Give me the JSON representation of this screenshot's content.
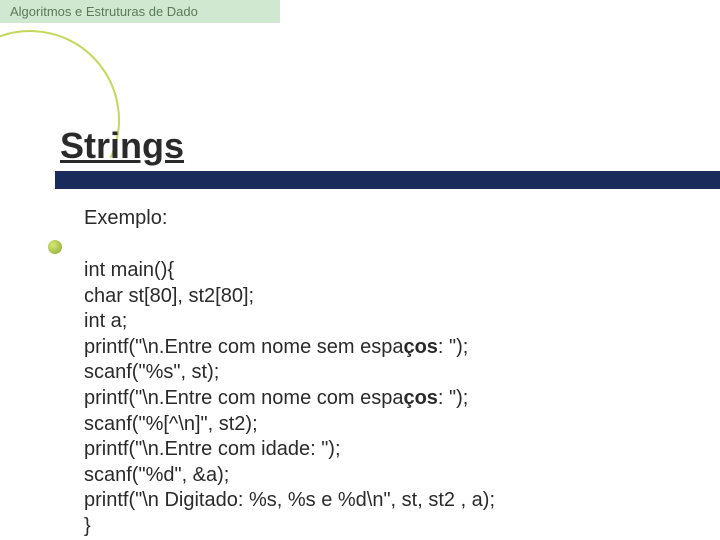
{
  "header": {
    "text": "Algoritmos e Estruturas de Dado"
  },
  "slide": {
    "title": "Strings",
    "subtitle": "Exemplo:",
    "code": {
      "l1": "int main(){",
      "l2": "char st[80], st2[80];",
      "l3": "int a;",
      "l4a": "printf(\"\\n.Entre com nome sem espa",
      "l4b": "ços",
      "l4c": ": \");",
      "l5": "scanf(\"%s\", st);",
      "l6a": "printf(\"\\n.Entre com nome com espa",
      "l6b": "ços",
      "l6c": ": \");",
      "l7": "scanf(\"%[^\\n]\", st2);",
      "l8": "printf(\"\\n.Entre com idade: \");",
      "l9": "scanf(\"%d\", &a);",
      "l10": "printf(\"\\n Digitado: %s, %s e %d\\n\", st, st2 , a);",
      "l11": "}"
    }
  }
}
